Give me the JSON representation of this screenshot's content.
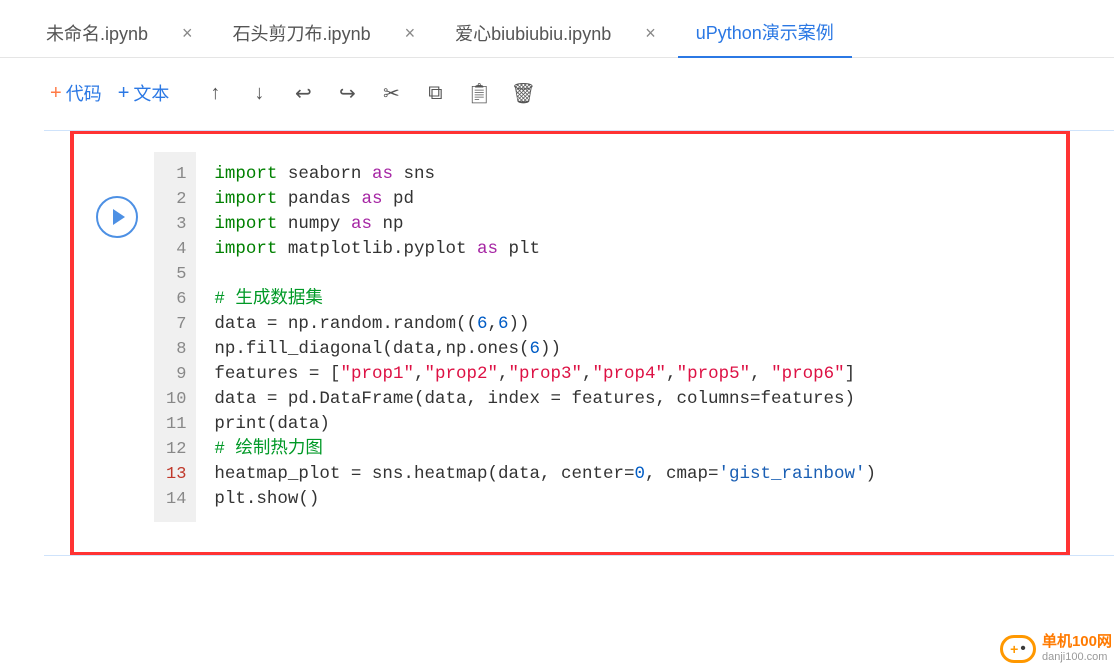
{
  "tabs": [
    {
      "label": "未命名.ipynb",
      "active": false
    },
    {
      "label": "石头剪刀布.ipynb",
      "active": false
    },
    {
      "label": "爱心biubiubiu.ipynb",
      "active": false
    },
    {
      "label": "uPython演示案例",
      "active": true
    }
  ],
  "toolbar": {
    "code_label": "代码",
    "text_label": "文本"
  },
  "code": {
    "lines": [
      {
        "n": 1,
        "tokens": [
          [
            "kw",
            "import"
          ],
          [
            "id",
            " seaborn "
          ],
          [
            "op",
            "as"
          ],
          [
            "id",
            " sns"
          ]
        ]
      },
      {
        "n": 2,
        "tokens": [
          [
            "kw",
            "import"
          ],
          [
            "id",
            " pandas "
          ],
          [
            "op",
            "as"
          ],
          [
            "id",
            " pd"
          ]
        ]
      },
      {
        "n": 3,
        "tokens": [
          [
            "kw",
            "import"
          ],
          [
            "id",
            " numpy "
          ],
          [
            "op",
            "as"
          ],
          [
            "id",
            " np"
          ]
        ]
      },
      {
        "n": 4,
        "tokens": [
          [
            "kw",
            "import"
          ],
          [
            "id",
            " matplotlib.pyplot "
          ],
          [
            "op",
            "as"
          ],
          [
            "id",
            " plt"
          ]
        ]
      },
      {
        "n": 5,
        "tokens": []
      },
      {
        "n": 6,
        "tokens": [
          [
            "cmt",
            "# 生成数据集"
          ]
        ]
      },
      {
        "n": 7,
        "tokens": [
          [
            "id",
            "data = np.random.random(("
          ],
          [
            "num",
            "6"
          ],
          [
            "id",
            ","
          ],
          [
            "num",
            "6"
          ],
          [
            "id",
            "))"
          ]
        ]
      },
      {
        "n": 8,
        "tokens": [
          [
            "id",
            "np.fill_diagonal(data,np.ones("
          ],
          [
            "num",
            "6"
          ],
          [
            "id",
            "))"
          ]
        ]
      },
      {
        "n": 9,
        "tokens": [
          [
            "id",
            "features = ["
          ],
          [
            "str",
            "\"prop1\""
          ],
          [
            "id",
            ","
          ],
          [
            "str",
            "\"prop2\""
          ],
          [
            "id",
            ","
          ],
          [
            "str",
            "\"prop3\""
          ],
          [
            "id",
            ","
          ],
          [
            "str",
            "\"prop4\""
          ],
          [
            "id",
            ","
          ],
          [
            "str",
            "\"prop5\""
          ],
          [
            "id",
            ", "
          ],
          [
            "str",
            "\"prop6\""
          ],
          [
            "id",
            "]"
          ]
        ]
      },
      {
        "n": 10,
        "tokens": [
          [
            "id",
            "data = pd.DataFrame(data, index = features, columns=features)"
          ]
        ]
      },
      {
        "n": 11,
        "tokens": [
          [
            "id",
            "print(data)"
          ]
        ]
      },
      {
        "n": 12,
        "tokens": [
          [
            "cmt",
            "# 绘制热力图"
          ]
        ]
      },
      {
        "n": 13,
        "hl": true,
        "tokens": [
          [
            "id",
            "heatmap_plot = sns.heatmap(data, center="
          ],
          [
            "num",
            "0"
          ],
          [
            "id",
            ", cmap="
          ],
          [
            "strblue",
            "'gist_rainbow'"
          ],
          [
            "id",
            ")"
          ]
        ]
      },
      {
        "n": 14,
        "tokens": [
          [
            "id",
            "plt.show()"
          ]
        ]
      }
    ]
  },
  "watermark": {
    "cn": "单机100网",
    "en": "danji100.com"
  }
}
